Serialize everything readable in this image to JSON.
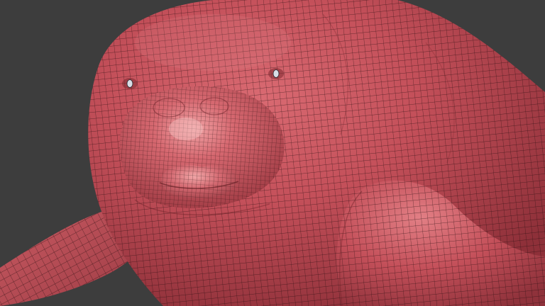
{
  "viewport": {
    "background_color": "#3d3d3d",
    "mesh_base_color": "#c4505a",
    "mesh_highlight_color": "#e98a8e",
    "mesh_shadow_color": "#8e3039",
    "wire_color": "#1e0a0c",
    "eye_color": "#d8dde6"
  }
}
